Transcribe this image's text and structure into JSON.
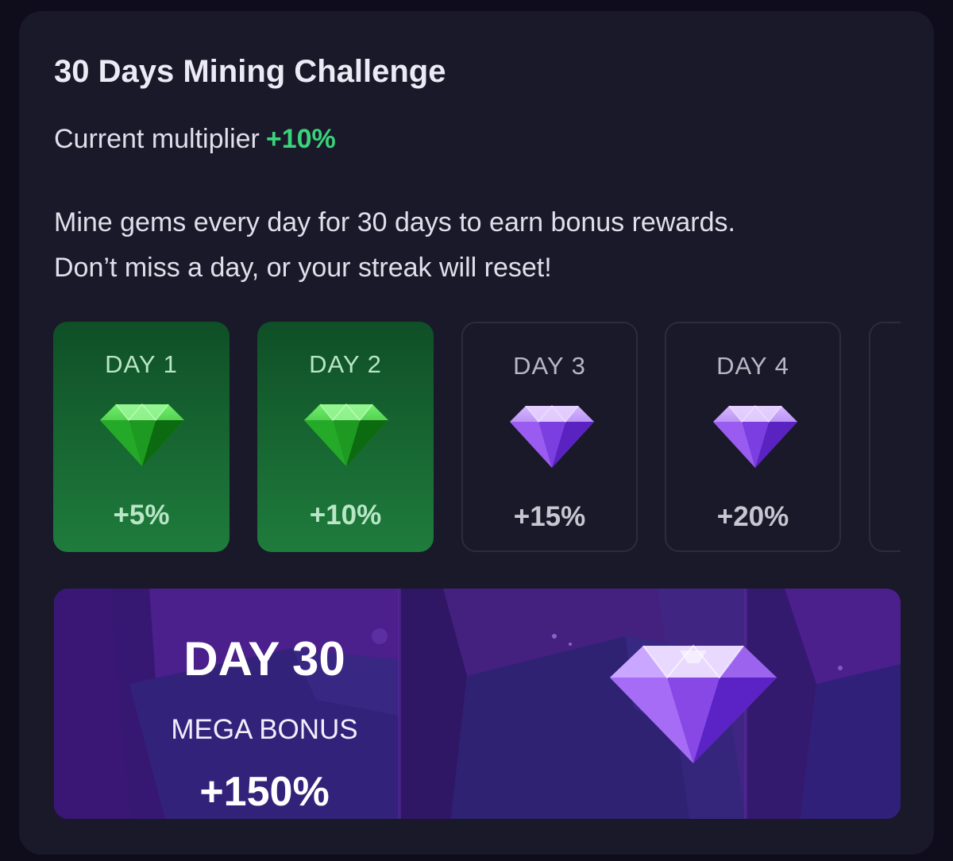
{
  "challenge": {
    "title": "30 Days Mining Challenge",
    "multiplier_label": "Current multiplier",
    "multiplier_value": "+10%",
    "description_line1": "Mine gems every day for 30 days to earn bonus rewards.",
    "description_line2": "Don’t miss a day, or your streak will reset!"
  },
  "days": [
    {
      "label": "DAY 1",
      "bonus": "+5%",
      "status": "completed",
      "gem": "green-gem-icon"
    },
    {
      "label": "DAY 2",
      "bonus": "+10%",
      "status": "completed",
      "gem": "green-gem-icon"
    },
    {
      "label": "DAY 3",
      "bonus": "+15%",
      "status": "upcoming",
      "gem": "purple-gem-icon"
    },
    {
      "label": "DAY 4",
      "bonus": "+20%",
      "status": "upcoming",
      "gem": "purple-gem-icon"
    }
  ],
  "mega": {
    "day": "DAY 30",
    "label": "MEGA BONUS",
    "bonus": "+150%",
    "gem": "large-purple-gem-icon"
  },
  "colors": {
    "background": "#0f0c1b",
    "card": "#191929",
    "accent_green": "#3ad37b",
    "completed_day": "#1f7c3c",
    "mega_banner": "#4a1f8a"
  }
}
